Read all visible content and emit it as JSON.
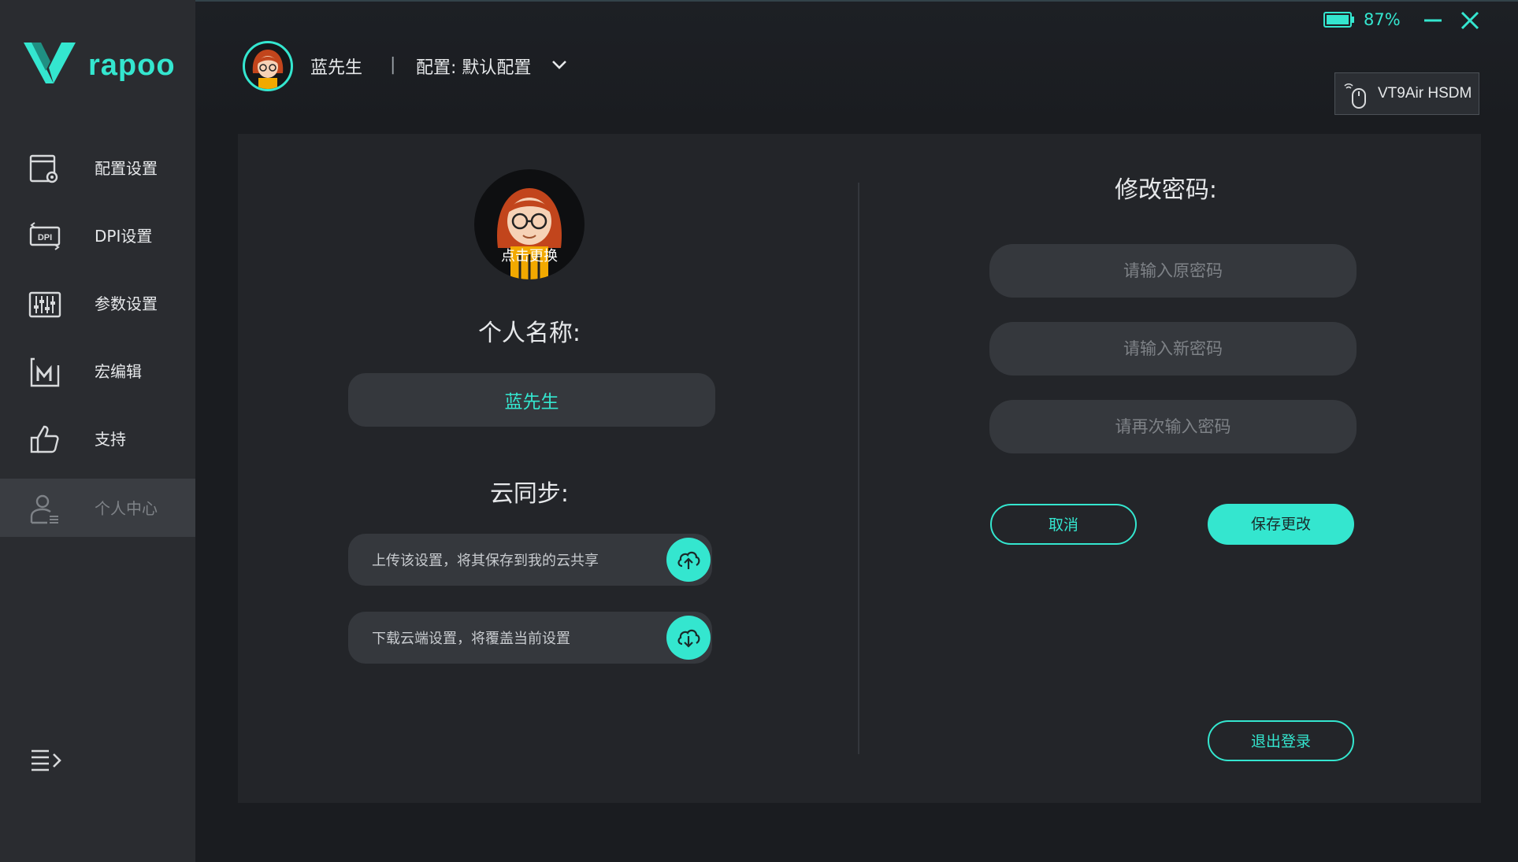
{
  "app": {
    "brand": "rapoo"
  },
  "sidebar": {
    "items": [
      {
        "label": "配置设置",
        "icon": "config-settings-icon"
      },
      {
        "label": "DPI设置",
        "icon": "dpi-icon"
      },
      {
        "label": "参数设置",
        "icon": "sliders-icon"
      },
      {
        "label": "宏编辑",
        "icon": "macro-icon"
      },
      {
        "label": "支持",
        "icon": "thumbs-up-icon"
      },
      {
        "label": "个人中心",
        "icon": "user-icon",
        "active": true
      }
    ]
  },
  "header": {
    "user_name": "蓝先生",
    "separator": "|",
    "config_label": "配置: 默认配置",
    "battery_pct": "87%",
    "device_name": "VT9Air HSDM"
  },
  "profile": {
    "avatar_caption": "点击更换",
    "name_title": "个人名称:",
    "name_value": "蓝先生",
    "sync_title": "云同步:",
    "upload_text": "上传该设置，将其保存到我的云共享",
    "download_text": "下载云端设置，将覆盖当前设置"
  },
  "password": {
    "title": "修改密码:",
    "old_placeholder": "请输入原密码",
    "new_placeholder": "请输入新密码",
    "confirm_placeholder": "请再次输入密码",
    "cancel_label": "取消",
    "save_label": "保存更改",
    "logout_label": "退出登录"
  },
  "colors": {
    "accent": "#34e6cf",
    "sidebar_bg": "#2a2c30",
    "panel_bg": "#232529",
    "field_bg": "#35383d"
  }
}
